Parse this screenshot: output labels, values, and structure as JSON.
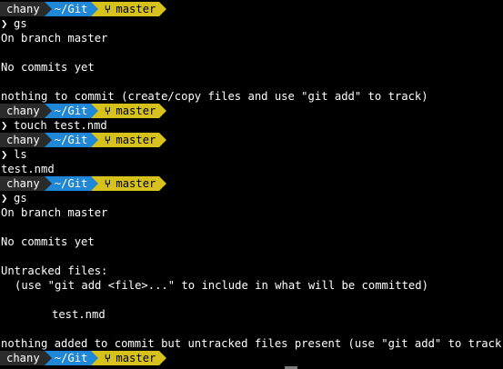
{
  "theme": {
    "background": "#000000",
    "user_segment_color": "#2b2b2b",
    "dir_segment_color": "#1f87d6",
    "git_segment_color": "#d6c21b"
  },
  "prompt": {
    "user": "chany",
    "dir": "~/Git",
    "branch": "master",
    "branch_icon": "git-branch-icon",
    "command_chevron": "❯"
  },
  "lines": [
    {
      "kind": "prompt"
    },
    {
      "kind": "command",
      "text": "gs"
    },
    {
      "kind": "output",
      "text": "On branch master"
    },
    {
      "kind": "blank"
    },
    {
      "kind": "output",
      "text": "No commits yet"
    },
    {
      "kind": "blank"
    },
    {
      "kind": "output",
      "text": "nothing to commit (create/copy files and use \"git add\" to track)"
    },
    {
      "kind": "prompt"
    },
    {
      "kind": "command",
      "text": "touch test.nmd"
    },
    {
      "kind": "prompt"
    },
    {
      "kind": "command",
      "text": "ls"
    },
    {
      "kind": "output",
      "text": "test.nmd"
    },
    {
      "kind": "prompt"
    },
    {
      "kind": "command",
      "text": "gs"
    },
    {
      "kind": "output",
      "text": "On branch master"
    },
    {
      "kind": "blank"
    },
    {
      "kind": "output",
      "text": "No commits yet"
    },
    {
      "kind": "blank"
    },
    {
      "kind": "output",
      "text": "Untracked files:"
    },
    {
      "kind": "output",
      "indent": 1,
      "text": "(use \"git add <file>...\" to include in what will be committed)"
    },
    {
      "kind": "blank"
    },
    {
      "kind": "output",
      "indent": 2,
      "text": "test.nmd"
    },
    {
      "kind": "blank"
    },
    {
      "kind": "output",
      "text": "nothing added to commit but untracked files present (use \"git add\" to track)"
    },
    {
      "kind": "prompt"
    }
  ]
}
